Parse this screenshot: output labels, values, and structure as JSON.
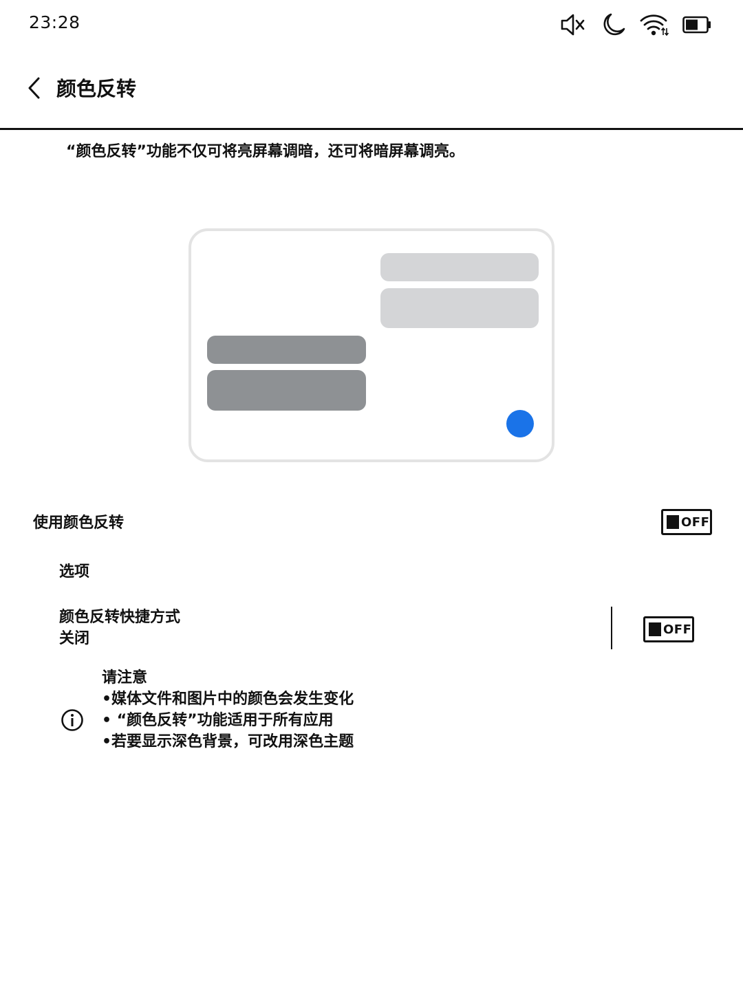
{
  "status_bar": {
    "time": "23:28",
    "icons": [
      "mute-icon",
      "do-not-disturb-moon-icon",
      "wifi-icon",
      "battery-icon"
    ]
  },
  "header": {
    "back_icon": "chevron-left-icon",
    "title": "颜色反转"
  },
  "intro_text": "“颜色反转”功能不仅可将亮屏幕调暗，还可将暗屏幕调亮。",
  "illustration": {
    "accent_color": "#1a73e8",
    "light_bubble_color": "#d4d5d7",
    "dark_bubble_color": "#8e9194"
  },
  "settings": {
    "use_inversion": {
      "label": "使用颜色反转",
      "toggle_label": "OFF",
      "enabled": false
    },
    "options": {
      "label": "选项"
    },
    "shortcut": {
      "label": "颜色反转快捷方式",
      "summary": "关闭",
      "toggle_label": "OFF",
      "enabled": false
    }
  },
  "notice": {
    "icon": "info-icon",
    "title": "请注意",
    "items": [
      "•媒体文件和图片中的颜色会发生变化",
      "• “颜色反转”功能适用于所有应用",
      "•若要显示深色背景，可改用深色主题"
    ]
  }
}
